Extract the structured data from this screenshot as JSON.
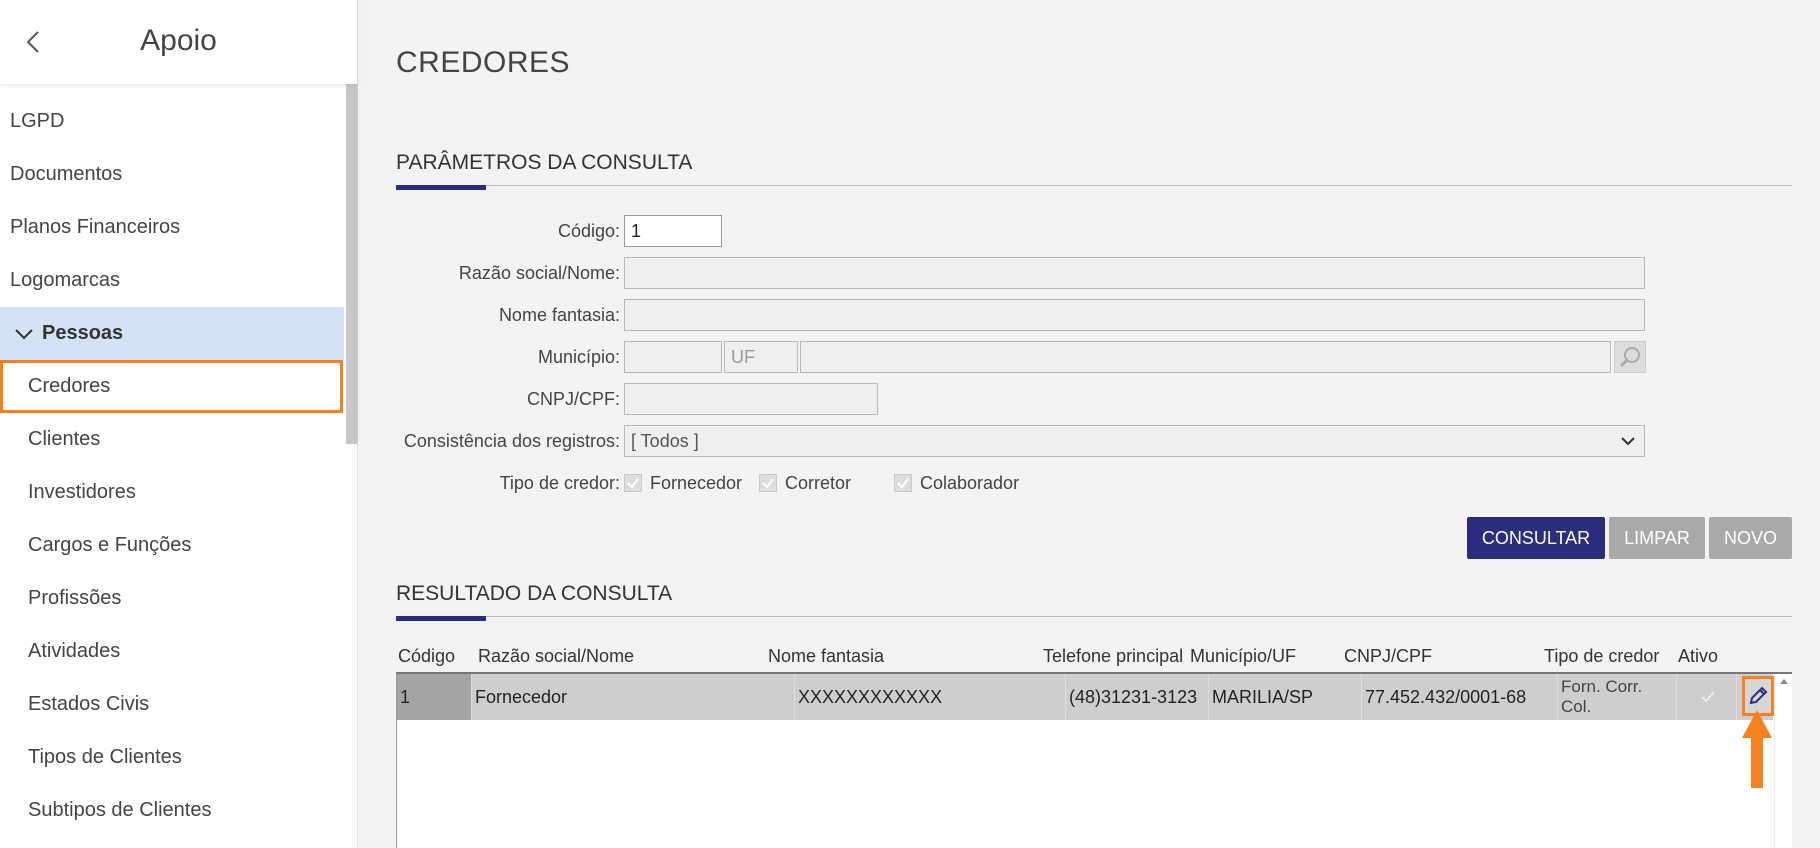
{
  "sidebar": {
    "title": "Apoio",
    "items": [
      {
        "label": "LGPD"
      },
      {
        "label": "Documentos"
      },
      {
        "label": "Planos Financeiros"
      },
      {
        "label": "Logomarcas"
      }
    ],
    "group": {
      "label": "Pessoas"
    },
    "subitems": [
      {
        "label": "Credores"
      },
      {
        "label": "Clientes"
      },
      {
        "label": "Investidores"
      },
      {
        "label": "Cargos e Funções"
      },
      {
        "label": "Profissões"
      },
      {
        "label": "Atividades"
      },
      {
        "label": "Estados Civis"
      },
      {
        "label": "Tipos de Clientes"
      },
      {
        "label": "Subtipos de Clientes"
      }
    ]
  },
  "page": {
    "title": "CREDORES"
  },
  "params": {
    "title": "PARÂMETROS DA CONSULTA",
    "codigo_label": "Código:",
    "codigo_value": "1",
    "razao_label": "Razão social/Nome:",
    "fantasia_label": "Nome fantasia:",
    "municipio_label": "Município:",
    "uf_placeholder": "UF",
    "cnpj_label": "CNPJ/CPF:",
    "consistencia_label": "Consistência dos registros:",
    "consistencia_value": "[ Todos ]",
    "tipo_label": "Tipo de credor:",
    "tipos": [
      {
        "label": "Fornecedor"
      },
      {
        "label": "Corretor"
      },
      {
        "label": "Colaborador"
      }
    ]
  },
  "buttons": {
    "consultar": "CONSULTAR",
    "limpar": "LIMPAR",
    "novo": "NOVO"
  },
  "results": {
    "title": "RESULTADO DA CONSULTA",
    "headers": [
      "Código",
      "Razão social/Nome",
      "Nome fantasia",
      "Telefone principal",
      "Município/UF",
      "CNPJ/CPF",
      "Tipo de credor",
      "Ativo"
    ],
    "rows": [
      {
        "codigo": "1",
        "razao": "Fornecedor",
        "fantasia": "XXXXXXXXXXXX",
        "telefone": "(48)31231-3123",
        "municipio": "MARILIA/SP",
        "cnpj": "77.452.432/0001-68",
        "tipo": "Forn. Corr. Col."
      }
    ]
  },
  "colors": {
    "primary": "#2b2e7e",
    "highlight": "#f5821f",
    "disabled": "#a9a9a9",
    "group_bg": "#d3e3f5"
  }
}
